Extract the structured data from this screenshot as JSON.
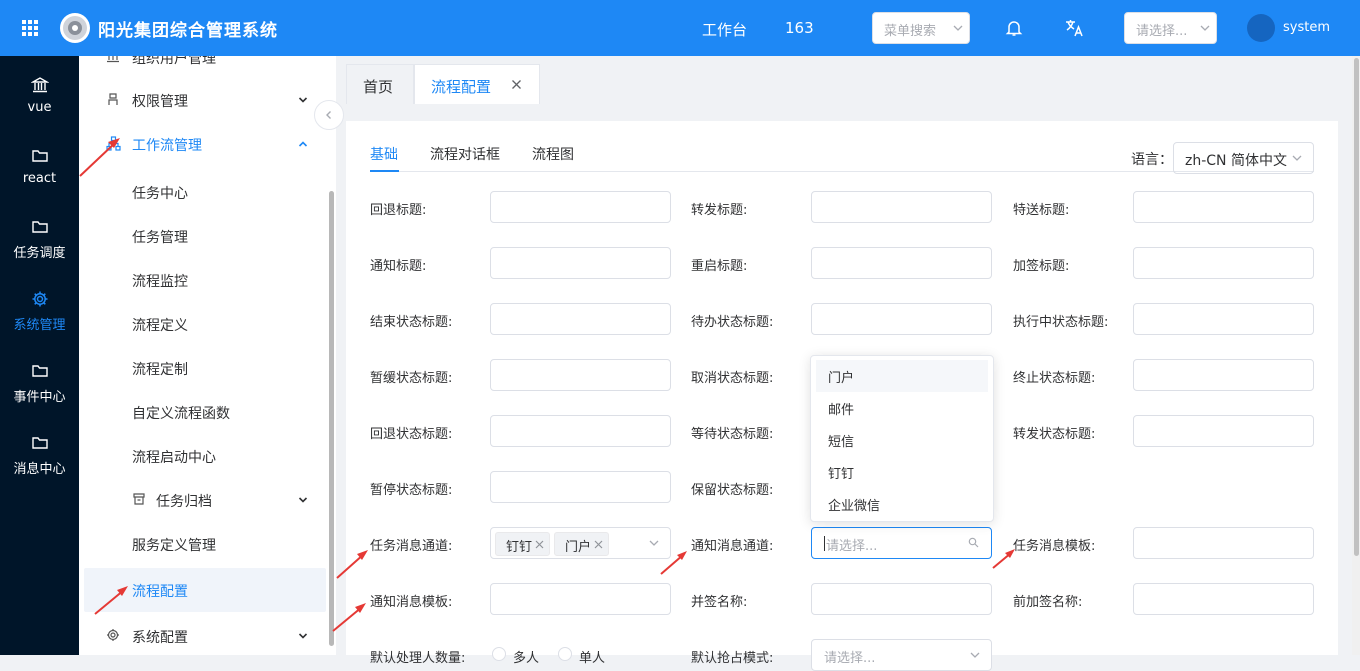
{
  "header": {
    "title": "阳光集团综合管理系统",
    "workbench": "工作台",
    "count": "163",
    "menu_search_placeholder": "菜单搜索",
    "select_placeholder": "请选择...",
    "username": "system",
    "icons": [
      "apps-grid-icon",
      "logo-icon",
      "bell-icon",
      "translate-icon",
      "avatar"
    ],
    "bg_color": "#1e88f5"
  },
  "leftnav": {
    "items": [
      {
        "label": "vue",
        "icon": "bank-icon"
      },
      {
        "label": "react",
        "icon": "folder-icon"
      },
      {
        "label": "任务调度",
        "icon": "folder-icon"
      },
      {
        "label": "系统管理",
        "icon": "gear-icon",
        "active": true
      },
      {
        "label": "事件中心",
        "icon": "folder-icon"
      },
      {
        "label": "消息中心",
        "icon": "folder-icon"
      }
    ],
    "bg_color": "#001529"
  },
  "sidemenu": {
    "items": [
      {
        "label": "组织用户管理"
      },
      {
        "label": "权限管理"
      },
      {
        "label": "工作流管理",
        "active": true
      },
      {
        "label": "任务中心"
      },
      {
        "label": "任务管理"
      },
      {
        "label": "流程监控"
      },
      {
        "label": "流程定义"
      },
      {
        "label": "流程定制"
      },
      {
        "label": "自定义流程函数"
      },
      {
        "label": "流程启动中心"
      },
      {
        "label": "任务归档"
      },
      {
        "label": "服务定义管理"
      },
      {
        "label": "流程配置",
        "selected": true
      },
      {
        "label": "系统配置"
      }
    ]
  },
  "tabs": [
    {
      "label": "首页"
    },
    {
      "label": "流程配置",
      "active": true
    }
  ],
  "panel": {
    "subtabs": [
      {
        "label": "基础",
        "active": true
      },
      {
        "label": "流程对话框"
      },
      {
        "label": "流程图"
      }
    ],
    "language_label": "语言：",
    "language_value": "zh-CN 简体中文",
    "fields": [
      {
        "label": "回退标题:",
        "value": ""
      },
      {
        "label": "转发标题:",
        "value": ""
      },
      {
        "label": "特送标题:",
        "value": ""
      },
      {
        "label": "通知标题:",
        "value": ""
      },
      {
        "label": "重启标题:",
        "value": ""
      },
      {
        "label": "加签标题:",
        "value": ""
      },
      {
        "label": "结束状态标题:",
        "value": ""
      },
      {
        "label": "待办状态标题:",
        "value": ""
      },
      {
        "label": "执行中状态标题:",
        "value": ""
      },
      {
        "label": "暂缓状态标题:",
        "value": ""
      },
      {
        "label": "取消状态标题:",
        "value": ""
      },
      {
        "label": "终止状态标题:",
        "value": ""
      },
      {
        "label": "回退状态标题:",
        "value": ""
      },
      {
        "label": "等待状态标题:",
        "value": ""
      },
      {
        "label": "转发状态标题:",
        "value": ""
      },
      {
        "label": "暂停状态标题:",
        "value": ""
      },
      {
        "label": "保留状态标题:",
        "value": ""
      },
      {
        "label": "任务消息通道:",
        "tags": [
          "钉钉",
          "门户"
        ]
      },
      {
        "label": "通知消息通道:",
        "placeholder": "请选择..."
      },
      {
        "label": "任务消息模板:",
        "value": ""
      },
      {
        "label": "通知消息模板:",
        "value": ""
      },
      {
        "label": "并签名称:",
        "value": ""
      },
      {
        "label": "前加签名称:",
        "value": ""
      },
      {
        "label": "默认处理人数量:",
        "options": [
          "多人",
          "单人"
        ]
      },
      {
        "label": "默认抢占模式:",
        "placeholder": "请选择..."
      }
    ],
    "dropdown_options": [
      "门户",
      "邮件",
      "短信",
      "钉钉",
      "企业微信"
    ]
  },
  "annotation_color": "#e53935"
}
